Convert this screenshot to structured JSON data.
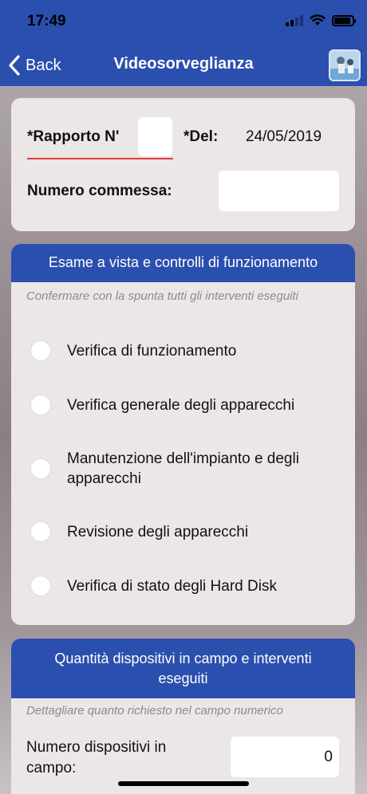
{
  "status": {
    "time": "17:49"
  },
  "nav": {
    "back_label": "Back",
    "title": "Videosorveglianza",
    "avatar_icon": "app-avatar-icon"
  },
  "report": {
    "rapporto_label": "*Rapporto N'",
    "rapporto_value": "",
    "del_label": "*Del:",
    "del_value": "24/05/2019",
    "commessa_label": "Numero commessa:",
    "commessa_value": ""
  },
  "section1": {
    "header": "Esame a vista e controlli di funzionamento",
    "hint": "Confermare con la spunta tutti gli interventi eseguiti",
    "items": [
      {
        "label": "Verifica di funzionamento",
        "checked": false
      },
      {
        "label": "Verifica generale degli apparecchi",
        "checked": false
      },
      {
        "label": "Manutenzione dell'impianto e degli apparecchi",
        "checked": false
      },
      {
        "label": "Revisione degli apparecchi",
        "checked": false
      },
      {
        "label": "Verifica di stato degli Hard Disk",
        "checked": false
      }
    ]
  },
  "section2": {
    "header": "Quantità dispositivi in campo e interventi eseguiti",
    "hint": "Dettagliare quanto richiesto nel campo numerico",
    "dispositivi_label": "Numero dispositivi in campo:",
    "dispositivi_value": "0"
  },
  "colors": {
    "accent": "#2b4fae",
    "card_bg": "#ebe7e6",
    "error_underline": "#e33b3b"
  }
}
